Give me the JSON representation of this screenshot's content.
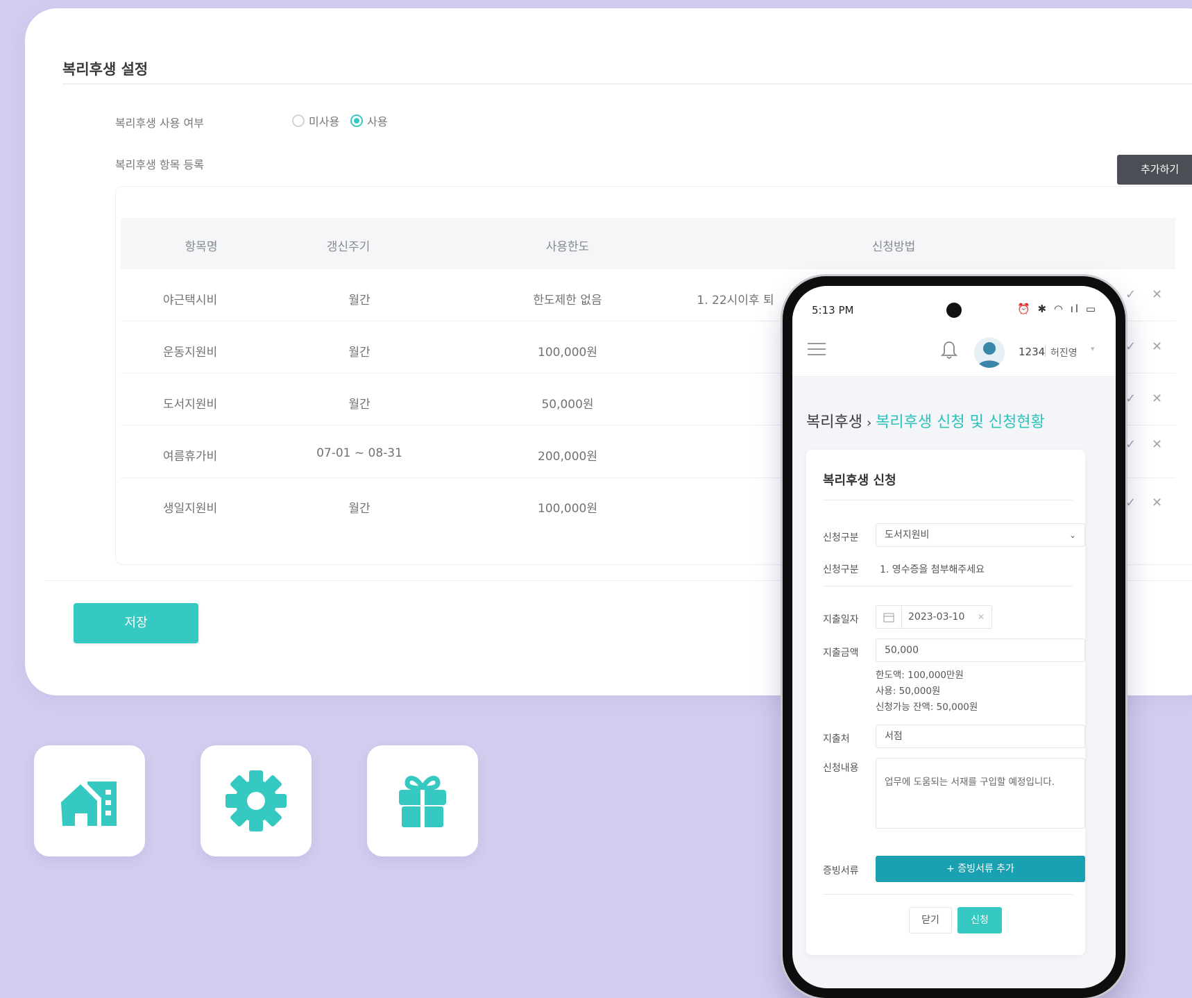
{
  "admin": {
    "title": "복리후생 설정",
    "use_label": "복리후생 사용 여부",
    "use_options": [
      "미사용",
      "사용"
    ],
    "use_selected": "사용",
    "items_label": "복리후생 항목 등록",
    "add_button": "추가하기",
    "columns": [
      "항목명",
      "갱신주기",
      "사용한도",
      "신청방법"
    ],
    "rows": [
      {
        "name": "야근택시비",
        "cycle": "월간",
        "limit": "한도제한 없음",
        "method": "1. 22시이후 퇴"
      },
      {
        "name": "운동지원비",
        "cycle": "월간",
        "limit": "100,000원",
        "method": ""
      },
      {
        "name": "도서지원비",
        "cycle": "월간",
        "limit": "50,000원",
        "method": ""
      },
      {
        "name": "여름휴가비",
        "cycle": "07-01 ~ 08-31",
        "limit": "200,000원",
        "method": ""
      },
      {
        "name": "생일지원비",
        "cycle": "월간",
        "limit": "100,000원",
        "method": ""
      }
    ],
    "save_button": "저장"
  },
  "tiles": [
    {
      "icon": "home-icon"
    },
    {
      "icon": "gear-icon"
    },
    {
      "icon": "gift-icon"
    }
  ],
  "phone": {
    "status": {
      "time": "5:13 PM",
      "icons": "⏰ ✱ ◠ ıl ▭"
    },
    "user": {
      "id": "1234",
      "name": "허진영"
    },
    "breadcrumb": {
      "parent": "복리후생",
      "sep": "›",
      "current": "복리후생 신청 및 신청현황"
    },
    "form": {
      "title": "복리후생 신청",
      "category_label": "신청구분",
      "category_value": "도서지원비",
      "method_label": "신청구분",
      "method_text": "1. 영수증을 첨부해주세요",
      "date_label": "지출일자",
      "date_value": "2023-03-10",
      "amount_label": "지출금액",
      "amount_value": "50,000",
      "limit_text": "한도액: 100,000만원",
      "used_text": "사용: 50,000원",
      "remain_text": "신청가능 잔액: 50,000원",
      "place_label": "지출처",
      "place_value": "서점",
      "content_label": "신청내용",
      "content_value": "업무에 도움되는 서재를 구입할 예정입니다.",
      "proof_label": "증빙서류",
      "proof_button": "+ 증빙서류 추가",
      "close_button": "닫기",
      "apply_button": "신청"
    }
  },
  "colors": {
    "accent": "#35c9c1",
    "proof": "#1aa1b1",
    "background": "#d3cdef"
  }
}
